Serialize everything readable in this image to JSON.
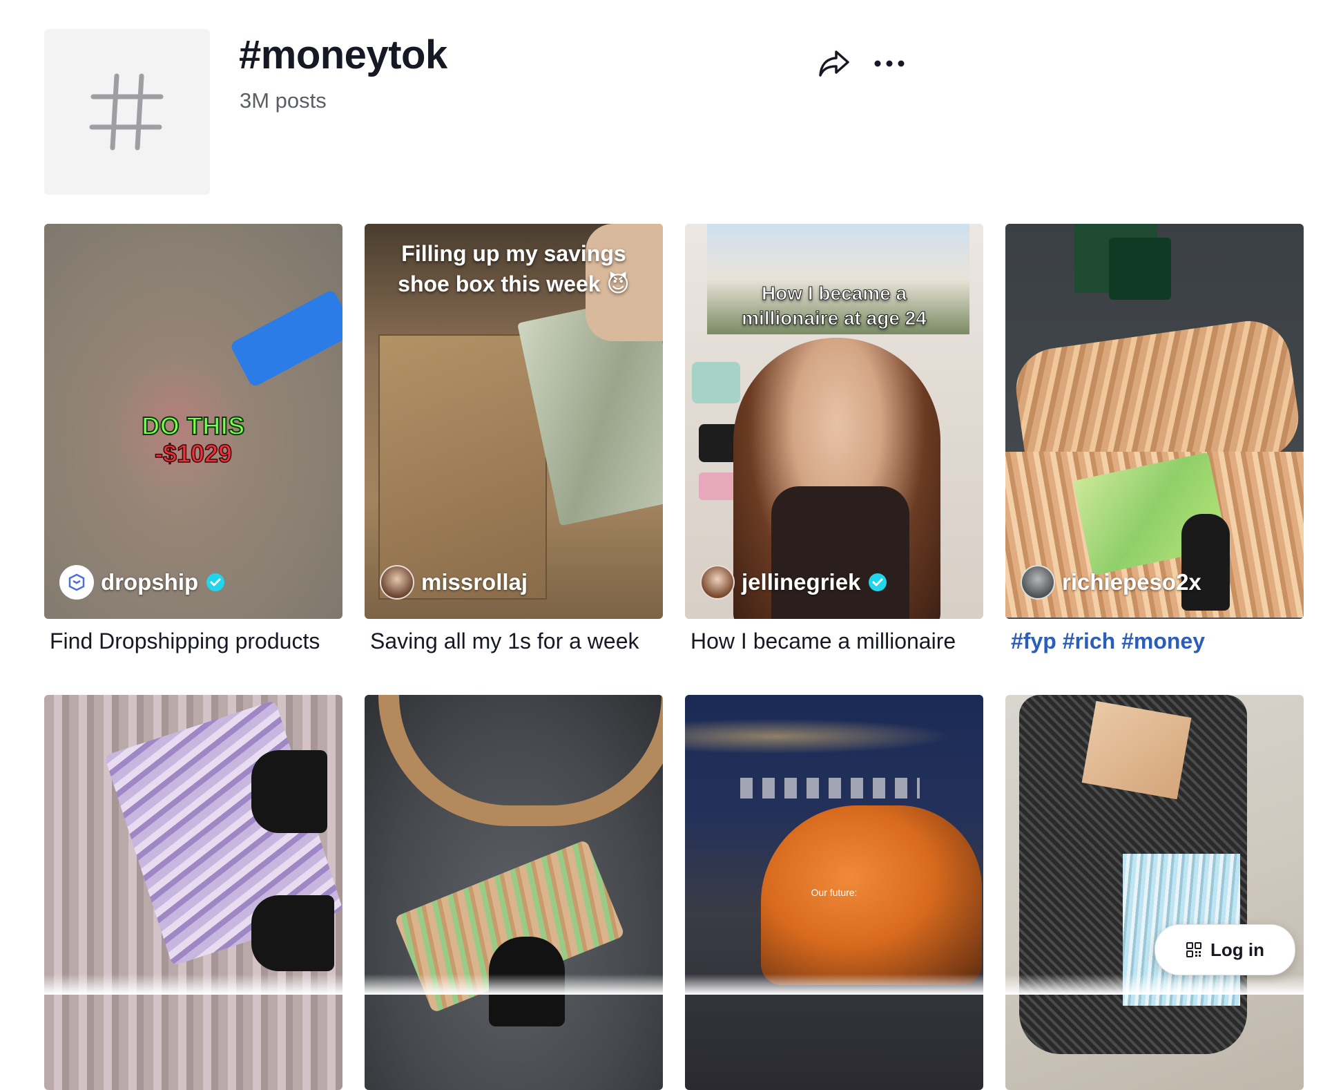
{
  "header": {
    "title": "#moneytok",
    "post_count": "3M posts",
    "icons": {
      "hashtag": "hashtag-icon",
      "share": "share-icon",
      "more": "more-icon"
    }
  },
  "videos": [
    {
      "author": "dropship",
      "verified": true,
      "caption": "Find Dropshipping products",
      "overlay_line1": "DO THIS",
      "overlay_line2": "-$1029",
      "caption_style": "text"
    },
    {
      "author": "missrollaj",
      "verified": false,
      "caption": "Saving all my 1s for a week",
      "overlay_line1": "Filling up my savings",
      "overlay_line2": "shoe box this week 😈",
      "caption_style": "text"
    },
    {
      "author": "jellinegriek",
      "verified": true,
      "caption": "How I became a millionaire",
      "overlay_line1": "How I became a",
      "overlay_line2": "millionaire at age 24",
      "caption_style": "text"
    },
    {
      "author": "richiepeso2x",
      "verified": false,
      "caption": "#fyp #rich #money",
      "caption_style": "hashtags"
    },
    {
      "author": "",
      "caption": ""
    },
    {
      "author": "",
      "caption": ""
    },
    {
      "author": "",
      "caption": "",
      "overlay_small": "Our future:"
    },
    {
      "author": "",
      "caption": ""
    }
  ],
  "login_button": {
    "label": "Log in",
    "icon": "qr-code-icon"
  },
  "colors": {
    "hashtag_link": "#2b5db9",
    "verified": "#20d5ec",
    "text": "#161823",
    "muted": "#5c5e66"
  }
}
